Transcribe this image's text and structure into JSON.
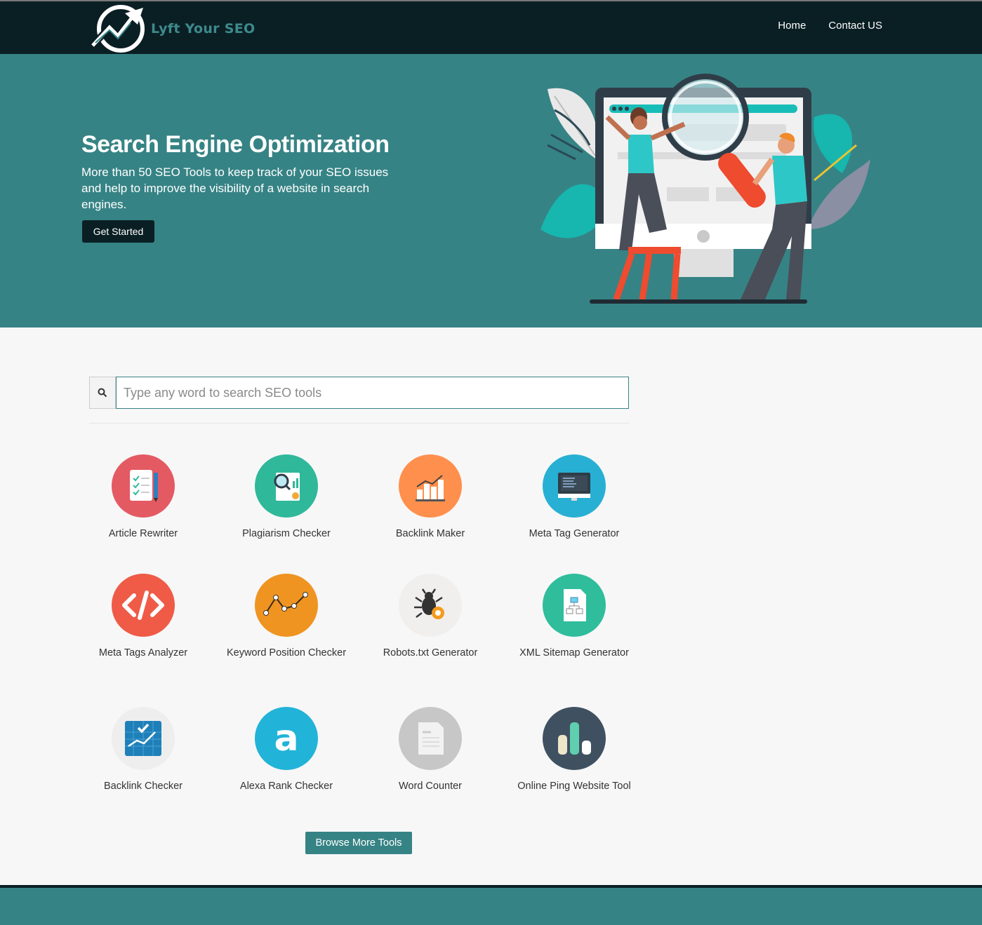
{
  "brand": {
    "name": "Lyft Your SEO"
  },
  "nav": {
    "home": "Home",
    "contact": "Contact US"
  },
  "hero": {
    "title": "Search Engine Optimization",
    "description": "More than 50 SEO Tools to keep track of your SEO issues and help to improve the visibility of a website in search engines.",
    "cta": "Get Started"
  },
  "search": {
    "placeholder": "Type any word to search SEO tools",
    "value": ""
  },
  "tools": [
    {
      "label": "Article Rewriter",
      "icon": "article-rewriter-icon",
      "color": "#e45a63"
    },
    {
      "label": "Plagiarism Checker",
      "icon": "plagiarism-checker-icon",
      "color": "#2fb89a"
    },
    {
      "label": "Backlink Maker",
      "icon": "backlink-maker-icon",
      "color": "#ff8f4c"
    },
    {
      "label": "Meta Tag Generator",
      "icon": "meta-tag-generator-icon",
      "color": "#27b0d3"
    },
    {
      "label": "Meta Tags Analyzer",
      "icon": "code-icon",
      "color": "#ef5b47"
    },
    {
      "label": "Keyword Position Checker",
      "icon": "keyword-position-icon",
      "color": "#ef9421"
    },
    {
      "label": "Robots.txt Generator",
      "icon": "bug-icon",
      "color": "#f1eeee"
    },
    {
      "label": "XML Sitemap Generator",
      "icon": "sitemap-icon",
      "color": "#2fbd9c"
    },
    {
      "label": "Backlink Checker",
      "icon": "backlink-chart-icon",
      "color": "#eeeeee"
    },
    {
      "label": "Alexa Rank Checker",
      "icon": "alexa-icon",
      "color": "#22b3d8"
    },
    {
      "label": "Word Counter",
      "icon": "document-icon",
      "color": "#c7c7c7"
    },
    {
      "label": "Online Ping Website Tool",
      "icon": "ping-bars-icon",
      "color": "#3f5161"
    }
  ],
  "browse": {
    "label": "Browse More Tools"
  },
  "colors": {
    "primary": "#368385",
    "dark": "#0a1f24",
    "background": "#f7f7f7"
  }
}
